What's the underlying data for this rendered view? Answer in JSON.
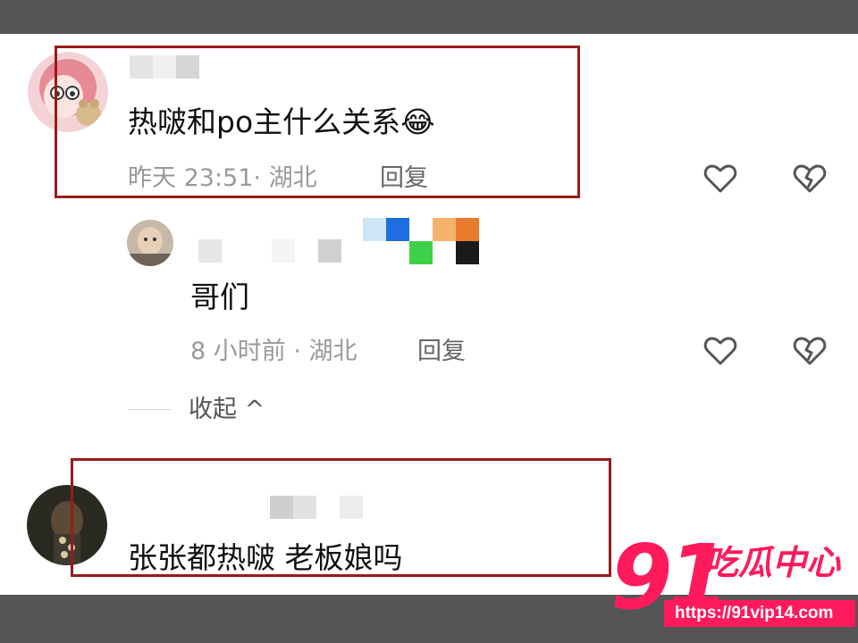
{
  "comments": [
    {
      "text": "热啵和po主什么关系😂",
      "time": "昨天 23:51",
      "location": "湖北",
      "reply_label": "回复"
    },
    {
      "text": "哥们",
      "time": "8 小时前",
      "location": "湖北",
      "reply_label": "回复"
    },
    {
      "text": "张张都热啵 老板娘吗"
    }
  ],
  "meta_separator": "·",
  "collapse_label": "收起 ^",
  "icons": [
    "heart-icon",
    "broken-heart-icon"
  ],
  "highlight_color": "#9a1b1b",
  "watermark": {
    "number": "91",
    "title": "吃瓜中心",
    "url": "https://91vip14.com",
    "color": "#ff1a5c"
  }
}
